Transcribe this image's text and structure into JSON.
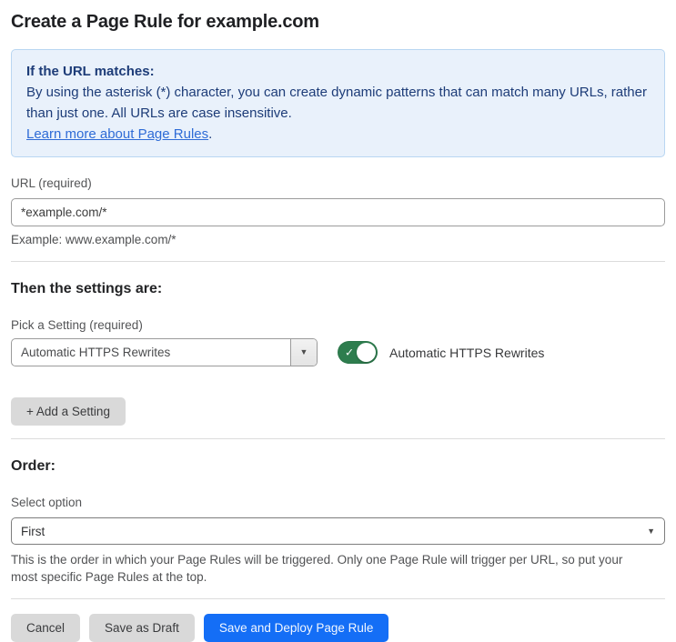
{
  "page": {
    "title": "Create a Page Rule for example.com"
  },
  "info_box": {
    "heading": "If the URL matches:",
    "body": "By using the asterisk (*) character, you can create dynamic patterns that can match many URLs, rather than just one. All URLs are case insensitive.",
    "link_label": "Learn more about Page Rules",
    "link_suffix": "."
  },
  "url_field": {
    "label": "URL (required)",
    "value": "*example.com/*",
    "helper": "Example: www.example.com/*"
  },
  "settings_section": {
    "heading": "Then the settings are:",
    "picker_label": "Pick a Setting (required)",
    "picker_value": "Automatic HTTPS Rewrites",
    "picker_caret_icon": "▼",
    "toggle_state": "on",
    "toggle_check_icon": "✓",
    "toggle_label": "Automatic HTTPS Rewrites",
    "add_setting_label": "+ Add a Setting"
  },
  "order_section": {
    "heading": "Order:",
    "select_label": "Select option",
    "select_value": "First",
    "select_caret_icon": "▼",
    "helper": "This is the order in which your Page Rules will be triggered. Only one Page Rule will trigger per URL, so put your most specific Page Rules at the top."
  },
  "footer": {
    "cancel_label": "Cancel",
    "save_draft_label": "Save as Draft",
    "save_deploy_label": "Save and Deploy Page Rule"
  },
  "colors": {
    "info_bg": "#e9f1fb",
    "info_border": "#b9d6f2",
    "info_text": "#1d3c78",
    "link_blue": "#2e6bd6",
    "toggle_green": "#2e7d4e",
    "primary_button_blue": "#146ef6",
    "secondary_button_gray": "#d9d9d9"
  }
}
